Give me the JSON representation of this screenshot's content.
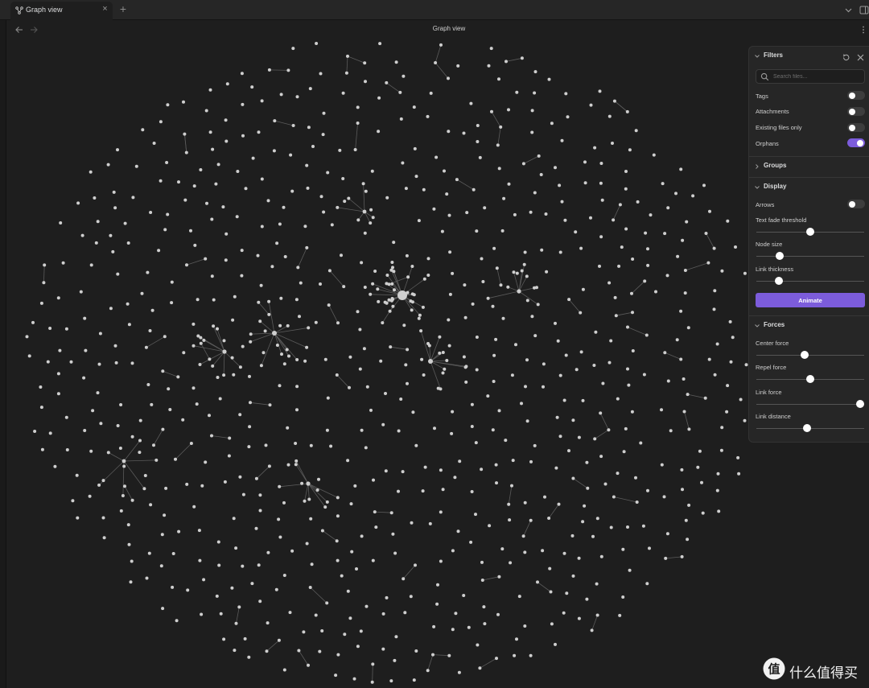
{
  "tab": {
    "title": "Graph view",
    "close": "×",
    "new_tab": "+"
  },
  "view": {
    "title": "Graph view"
  },
  "filters": {
    "title": "Filters",
    "search_placeholder": "Search files...",
    "toggles": [
      {
        "label": "Tags",
        "on": false
      },
      {
        "label": "Attachments",
        "on": false
      },
      {
        "label": "Existing files only",
        "on": false
      },
      {
        "label": "Orphans",
        "on": true
      }
    ]
  },
  "groups": {
    "title": "Groups"
  },
  "display": {
    "title": "Display",
    "arrows": {
      "label": "Arrows",
      "on": false
    },
    "sliders": [
      {
        "label": "Text fade threshold",
        "value": 0.5
      },
      {
        "label": "Node size",
        "value": 0.22
      },
      {
        "label": "Link thickness",
        "value": 0.21
      }
    ],
    "animate": "Animate"
  },
  "forces": {
    "title": "Forces",
    "sliders": [
      {
        "label": "Center force",
        "value": 0.45
      },
      {
        "label": "Repel force",
        "value": 0.5
      },
      {
        "label": "Link force",
        "value": 0.96
      },
      {
        "label": "Link distance",
        "value": 0.47
      }
    ]
  },
  "watermark": {
    "text": "什么值得买"
  },
  "colors": {
    "accent": "#7c5cdb",
    "node": "#cfcfcf",
    "edge": "#5a5a5a",
    "background": "#1e1e1e",
    "panel": "#262626"
  }
}
